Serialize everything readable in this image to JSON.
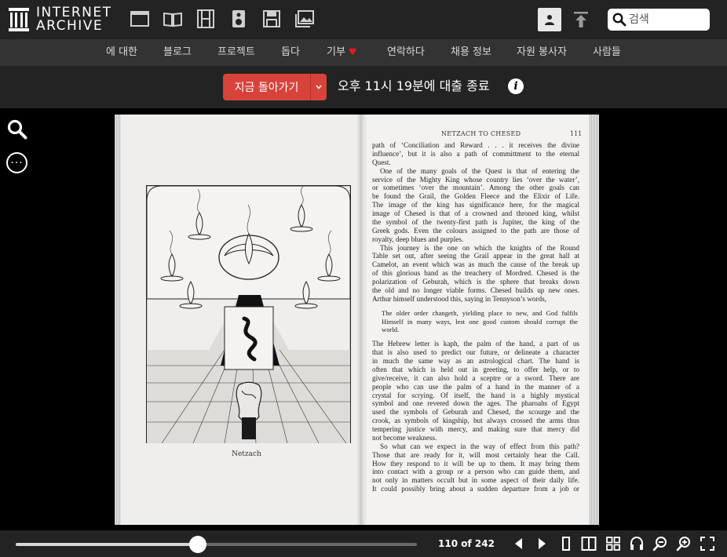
{
  "header": {
    "logo_line1": "INTERNET",
    "logo_line2": "ARCHIVE",
    "media_icons": [
      "web-icon",
      "texts-icon",
      "video-icon",
      "audio-icon",
      "software-icon",
      "images-icon"
    ],
    "search_placeholder": "검색"
  },
  "nav": {
    "items": [
      "에 대한",
      "블로그",
      "프로젝트",
      "돕다",
      "기부",
      "연락하다",
      "채용 정보",
      "자원 봉사자",
      "사람들"
    ],
    "heart_color": "#e01a22"
  },
  "loan": {
    "return_label": "지금 돌아가기",
    "status_text": "오후 11시 19분에 대출 종료",
    "button_color": "#d7433b"
  },
  "book": {
    "caption": "Netzach",
    "running_head": "NETZACH TO CHESED",
    "folio": "111",
    "paragraph1": [
      "path of ‘Conciliation and Reward . . . it receives the divine",
      "influence’, but it is also a path of committment to the eternal",
      "Quest."
    ],
    "paragraph2": [
      "One of the many goals of the Quest is that of entering the",
      "service of the Mighty King whose country lies ‘over the water’,",
      "or sometimes ‘over the mountain’. Among the other goals can",
      "be found the Grail, the Golden Fleece and the Elixir of Life.",
      "The image of the king has significance here, for the magical",
      "image of Chesed is that of a crowned and throned king, whilst",
      "the symbol of the twenty-first path is Jupiter, the king of the",
      "Greek gods. Even the colours assigned to the path are those of",
      "royalty, deep blues and purples."
    ],
    "paragraph3": [
      "This journey is the one on which the knights of the Round",
      "Table set out, after seeing the Grail appear in the great hall at",
      "Camelot, an event which was as much the cause of the break up",
      "of this glorious band as the treachery of Mordred. Chesed is the",
      "polarization of Geburah, which is the sphere that breaks down",
      "the old and no longer viable forms. Chesed builds up new ones.",
      "Arthur himself understood this, saying in Tennyson’s words,"
    ],
    "quote": [
      "The older order changeth, yielding place to new, and God fulfils",
      "Himself in many ways, lest one good custom should corrupt the",
      "world."
    ],
    "paragraph4": [
      "The Hebrew letter is kaph, the palm of the hand, a part of us",
      "that is also used to predict our future, or delineate a character",
      "in much the same way as an astrological chart. The hand is",
      "often that which is held out in greeting, to offer help, or to",
      "give/receive, it can also hold a sceptre or a sword. There are",
      "people who can use the palm of a hand in the manner of a",
      "crystal for scrying. Of itself, the hand is a highly mystical",
      "symbol and one revered down the ages. The pharoahs of Egypt",
      "used the symbols of Geburah and Chesed, the scourge and the",
      "crook, as symbols of kingship, but always crossed the arms thus",
      "tempering justice with mercy, and making sure that mercy did",
      "not become weakness."
    ],
    "paragraph5": [
      "So what can we expect in the way of effect from this path?",
      "Those that are ready for it, will most certainly hear the Call.",
      "How they respond to it will be up to them. It may bring them",
      "into contact with a group or a person who can guide them, and",
      "not only in matters occult but in some aspect of their daily life.",
      "It could possibly bring about a sudden departure from a job or"
    ]
  },
  "reader": {
    "page_label": "110 of 242",
    "progress": 0.4545,
    "current_page": 110,
    "total_pages": 242,
    "controls": [
      "prev-page-icon",
      "next-page-icon",
      "one-page-view-icon",
      "two-page-view-icon",
      "thumbnail-view-icon",
      "read-aloud-icon",
      "zoom-out-icon",
      "zoom-in-icon",
      "fullscreen-icon"
    ]
  }
}
